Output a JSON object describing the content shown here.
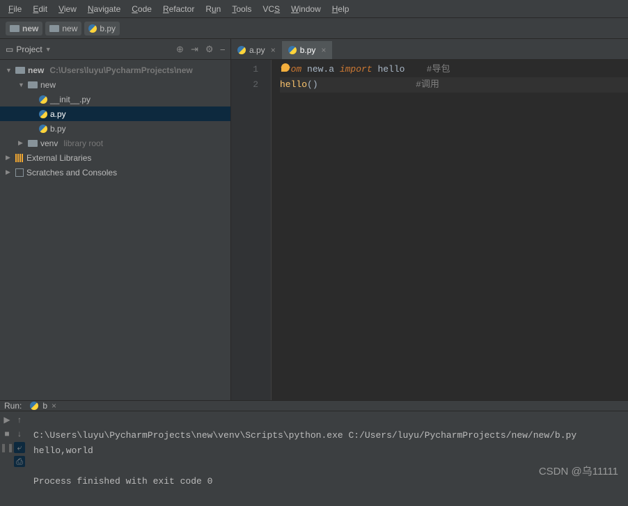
{
  "menu": [
    "File",
    "Edit",
    "View",
    "Navigate",
    "Code",
    "Refactor",
    "Run",
    "Tools",
    "VCS",
    "Window",
    "Help"
  ],
  "breadcrumbs": [
    {
      "icon": "folder",
      "label": "new"
    },
    {
      "icon": "folder",
      "label": "new"
    },
    {
      "icon": "py",
      "label": "b.py"
    }
  ],
  "sidebar": {
    "title": "Project",
    "tree": {
      "root": {
        "name": "new",
        "path": "C:\\Users\\luyu\\PycharmProjects\\new"
      },
      "pkg": {
        "name": "new"
      },
      "files": [
        {
          "name": "__init__.py",
          "icon": "py"
        },
        {
          "name": "a.py",
          "icon": "py",
          "selected": true
        },
        {
          "name": "b.py",
          "icon": "py-run"
        }
      ],
      "venv": {
        "name": "venv",
        "hint": "library root"
      },
      "ext": "External Libraries",
      "scratch": "Scratches and Consoles"
    }
  },
  "editor": {
    "tabs": [
      {
        "label": "a.py",
        "active": false
      },
      {
        "label": "b.py",
        "active": true
      }
    ],
    "gutter": [
      "1",
      "2"
    ],
    "code": {
      "line1": {
        "kw1": "from",
        "mod": " new.a ",
        "kw2": "import",
        "name": " hello",
        "comment": "#导包"
      },
      "line2": {
        "fn": "hello",
        "call": "()",
        "comment": "#调用"
      }
    }
  },
  "run": {
    "title": "Run:",
    "tab": "b",
    "output": {
      "cmd": "C:\\Users\\luyu\\PycharmProjects\\new\\venv\\Scripts\\python.exe C:/Users/luyu/PycharmProjects/new/new/b.py",
      "out": "hello,world",
      "blank": "",
      "exit": "Process finished with exit code 0"
    }
  },
  "watermark": "CSDN @乌11111"
}
